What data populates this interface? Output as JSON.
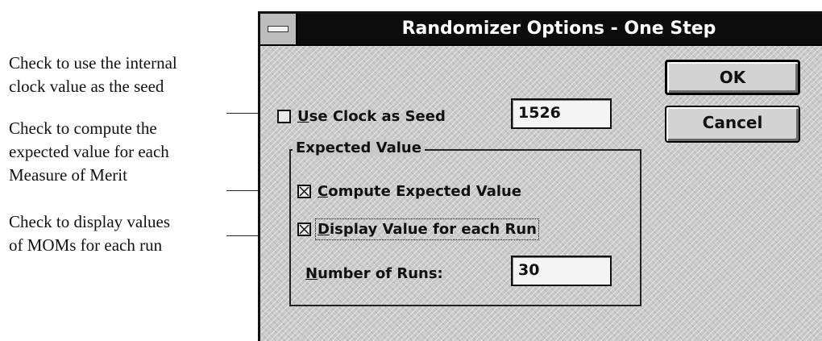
{
  "annotations": {
    "seed_note": "Check to use the internal\nclock value as the seed",
    "expected_note": "Check to compute the\nexpected value for each\nMeasure of Merit",
    "display_note": "Check to display values\nof MOMs for each run"
  },
  "dialog": {
    "title": "Randomizer Options - One Step",
    "ok_label": "OK",
    "cancel_label": "Cancel",
    "use_clock": {
      "label_accel": "U",
      "label_rest": "se Clock as Seed",
      "checked": false,
      "value": "1526"
    },
    "expected_group": {
      "title": "Expected Value",
      "compute": {
        "label_accel": "C",
        "label_rest": "ompute Expected Value",
        "checked": true
      },
      "display": {
        "label_accel": "D",
        "label_rest": "isplay Value for each Run",
        "checked": true
      },
      "runs": {
        "label_accel": "N",
        "label_rest": "umber of Runs:",
        "value": "30"
      }
    }
  }
}
